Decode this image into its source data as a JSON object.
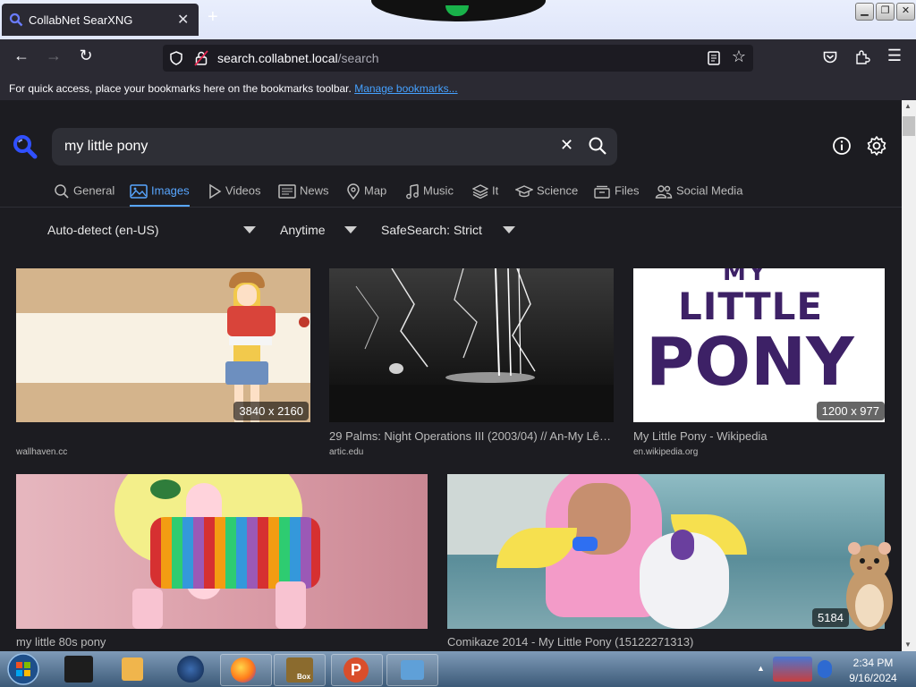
{
  "browser": {
    "tab_title": "CollabNet SearXNG",
    "new_tab_label": "+",
    "url_host": "search.collabnet.local",
    "url_path": "/search",
    "bookmarks_text": "For quick access, place your bookmarks here on the bookmarks toolbar.",
    "bookmarks_link": "Manage bookmarks..."
  },
  "search": {
    "query": "my little pony",
    "categories": [
      {
        "label": "General",
        "icon": "search-icon",
        "active": false
      },
      {
        "label": "Images",
        "icon": "image-icon",
        "active": true
      },
      {
        "label": "Videos",
        "icon": "play-icon",
        "active": false
      },
      {
        "label": "News",
        "icon": "newspaper-icon",
        "active": false
      },
      {
        "label": "Map",
        "icon": "map-pin-icon",
        "active": false
      },
      {
        "label": "Music",
        "icon": "music-icon",
        "active": false
      },
      {
        "label": "It",
        "icon": "layers-icon",
        "active": false
      },
      {
        "label": "Science",
        "icon": "science-icon",
        "active": false
      },
      {
        "label": "Files",
        "icon": "files-icon",
        "active": false
      },
      {
        "label": "Social Media",
        "icon": "people-icon",
        "active": false
      }
    ],
    "filters": {
      "language": "Auto-detect (en-US)",
      "time": "Anytime",
      "safesearch": "SafeSearch: Strict"
    }
  },
  "results": [
    {
      "title": "",
      "source": "wallhaven.cc",
      "dims": "3840 x 2160"
    },
    {
      "title": "29 Palms: Night Operations III (2003/04) // An-My Lê…",
      "source": "artic.edu",
      "dims": ""
    },
    {
      "title": "My Little Pony - Wikipedia",
      "source": "en.wikipedia.org",
      "dims": "1200 x 977"
    },
    {
      "title": "my little 80s pony",
      "source": "",
      "dims": ""
    },
    {
      "title": "Comikaze 2014 - My Little Pony (15122271313)",
      "source": "",
      "dims": "5184"
    }
  ],
  "logo_text": {
    "line1": "MY",
    "line2": "LITTLE",
    "line3": "PONY"
  },
  "taskbar": {
    "clock_time": "2:34 PM",
    "clock_date": "9/16/2024",
    "box_label": "Box"
  },
  "colors": {
    "accent": "#58a6ff",
    "page_bg": "#1c1c21",
    "searx_blue": "#3050ff"
  }
}
